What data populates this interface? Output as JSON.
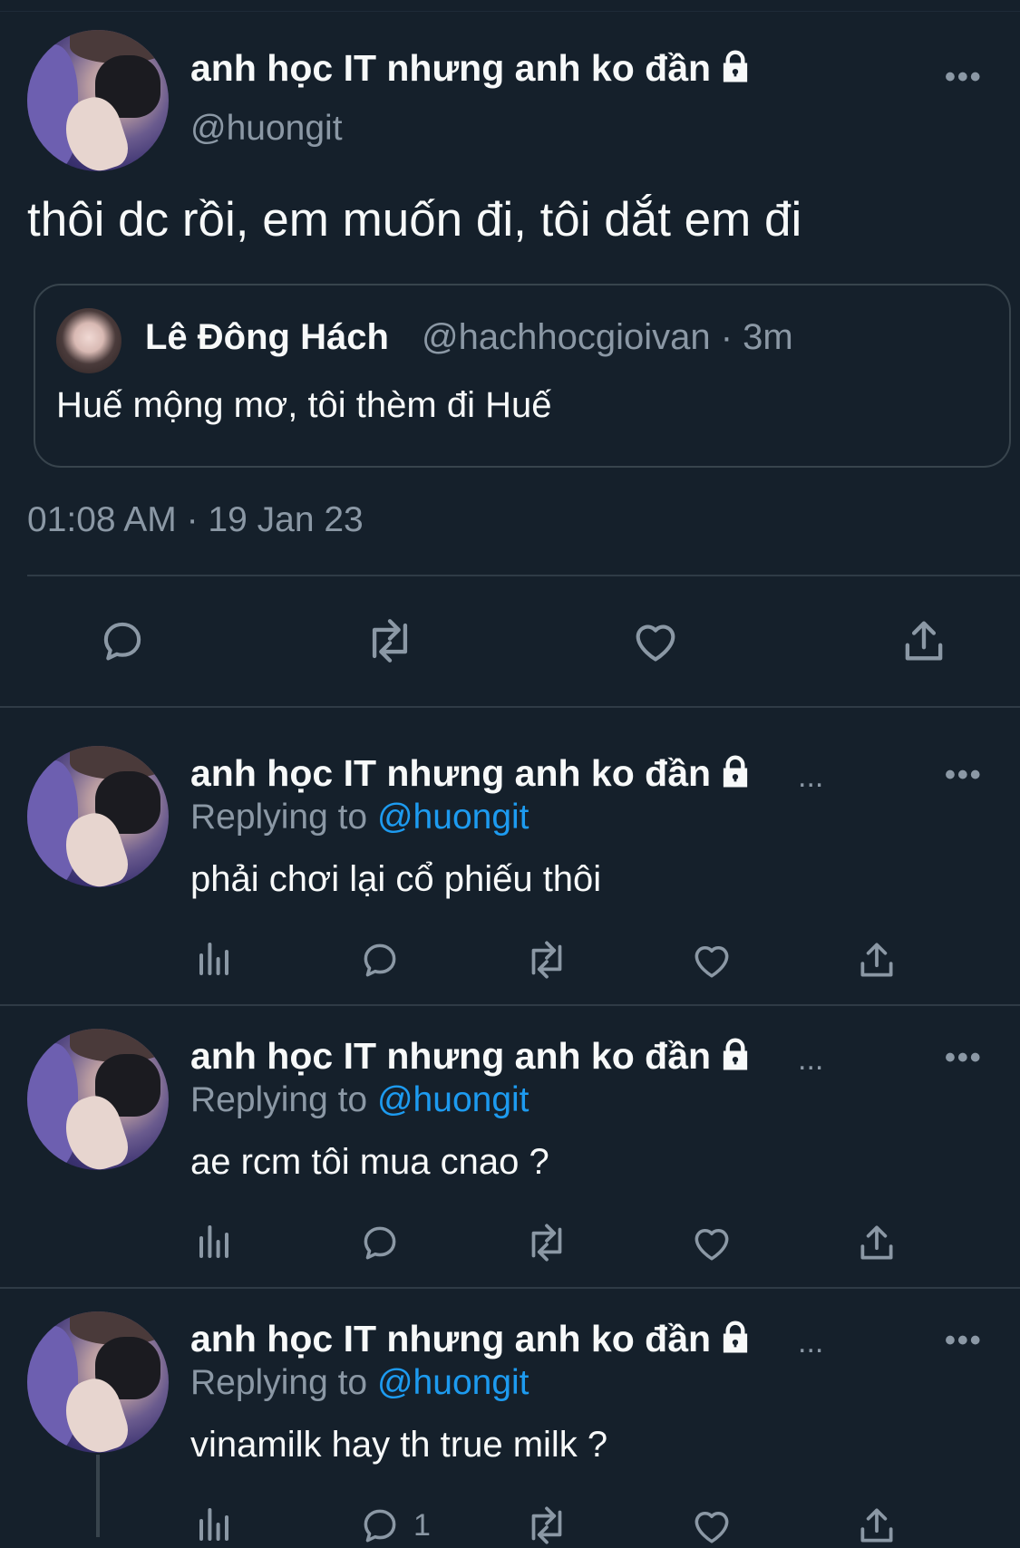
{
  "main_tweet": {
    "author_name": "anh học IT nhưng anh ko đần",
    "handle": "@huongit",
    "text": "thôi dc rồi, em muốn đi, tôi dắt em đi",
    "quoted": {
      "author_name": "Lê Đông Hách",
      "meta": "@hachhocgioivan · 3m",
      "text": "Huế mộng mơ, tôi thèm đi Huế"
    },
    "timestamp": "01:08 AM · 19 Jan 23",
    "more": "•••"
  },
  "replies": [
    {
      "author_name": "anh học IT nhưng anh ko đần",
      "truncation": "...",
      "replying_prefix": "Replying to",
      "replying_mention": "@huongit",
      "text": "phải chơi lại cổ phiếu thôi",
      "more": "•••"
    },
    {
      "author_name": "anh học IT nhưng anh ko đần",
      "truncation": "...",
      "replying_prefix": "Replying to",
      "replying_mention": "@huongit",
      "text": "ae rcm tôi mua cnao ?",
      "more": "•••"
    },
    {
      "author_name": "anh học IT nhưng anh ko đần",
      "truncation": "...",
      "replying_prefix": "Replying to",
      "replying_mention": "@huongit",
      "text": "vinamilk hay th true milk ?",
      "more": "•••",
      "reply_count": "1"
    }
  ],
  "icons": {
    "reply": "reply-icon",
    "retweet": "retweet-icon",
    "like": "like-icon",
    "share": "share-icon",
    "views": "views-icon",
    "lock": "lock-icon"
  },
  "colors": {
    "background": "#15202b",
    "text": "#f7f9f9",
    "secondary": "#8b98a5",
    "accent": "#1d9bf0",
    "divider": "#2f3b46"
  }
}
